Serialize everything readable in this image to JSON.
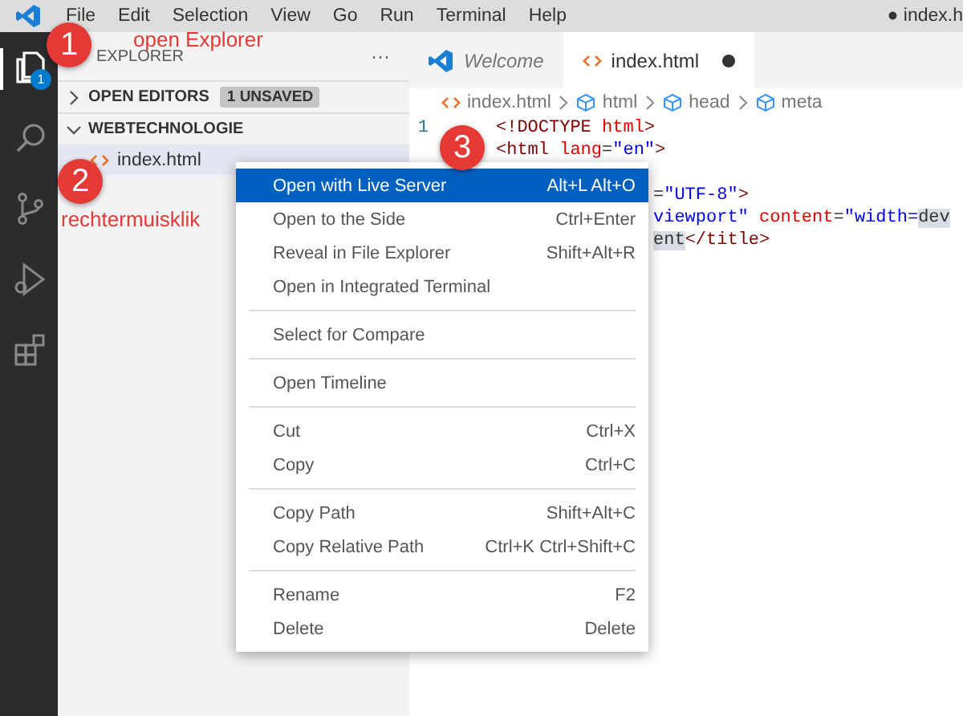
{
  "menubar": {
    "items": [
      "File",
      "Edit",
      "Selection",
      "View",
      "Go",
      "Run",
      "Terminal",
      "Help"
    ],
    "title": "● index.h"
  },
  "activity_bar": [
    {
      "kind": "files",
      "selected": true,
      "badge": "1"
    },
    {
      "kind": "search",
      "selected": false
    },
    {
      "kind": "branch",
      "selected": false
    },
    {
      "kind": "run",
      "selected": false
    },
    {
      "kind": "extensions",
      "selected": false
    }
  ],
  "sidebar": {
    "title": "EXPLORER",
    "more": "···",
    "sections": [
      {
        "label": "OPEN EDITORS",
        "expanded": false,
        "badge": "1 UNSAVED"
      },
      {
        "label": "WEBTECHNOLOGIE",
        "expanded": true,
        "files": [
          {
            "name": "index.html",
            "selected": true
          }
        ]
      }
    ]
  },
  "tabs": [
    {
      "label": "Welcome",
      "kind": "welcome",
      "selected": false,
      "modified": false
    },
    {
      "label": "index.html",
      "kind": "html",
      "selected": true,
      "modified": true
    }
  ],
  "breadcrumbs": [
    {
      "label": "index.html",
      "kind": "html"
    },
    {
      "label": "html",
      "kind": "element"
    },
    {
      "label": "head",
      "kind": "element"
    },
    {
      "label": "meta",
      "kind": "element"
    }
  ],
  "code": [
    {
      "number": "1",
      "kind": "full",
      "tokens": [
        {
          "text": "<!DOCTYPE ",
          "kind": "tag"
        },
        {
          "text": "html",
          "kind": "attr"
        },
        {
          "text": ">",
          "kind": "tag"
        }
      ]
    },
    {
      "kind": "full",
      "tokens": [
        {
          "text": "<html ",
          "kind": "tag"
        },
        {
          "text": "lang",
          "kind": "attr"
        },
        {
          "text": "=",
          "kind": "text"
        },
        {
          "text": "\"en\"",
          "kind": "value"
        },
        {
          "text": ">",
          "kind": "tag"
        }
      ]
    },
    {
      "kind": "partial"
    },
    {
      "kind": "partial",
      "tokens": [
        {
          "text": "=",
          "kind": "text"
        },
        {
          "text": "\"UTF-8\"",
          "kind": "value"
        },
        {
          "text": ">",
          "kind": "tag"
        }
      ]
    },
    {
      "kind": "partial",
      "tokens": [
        {
          "text": "viewport\"",
          "kind": "value"
        },
        {
          "text": " content",
          "kind": "attr"
        },
        {
          "text": "=",
          "kind": "text"
        },
        {
          "text": "\"width=",
          "kind": "value"
        },
        {
          "text": "dev",
          "kind": "highlight"
        }
      ]
    },
    {
      "kind": "partial",
      "tokens": [
        {
          "text": "ent",
          "kind": "highlight"
        },
        {
          "text": "</title>",
          "kind": "tag"
        }
      ]
    }
  ],
  "context_menu": {
    "groups": [
      [
        {
          "label": "Open with Live Server",
          "shortcut": "Alt+L Alt+O",
          "selected": true
        },
        {
          "label": "Open to the Side",
          "shortcut": "Ctrl+Enter",
          "selected": false
        },
        {
          "label": "Reveal in File Explorer",
          "shortcut": "Shift+Alt+R",
          "selected": false
        },
        {
          "label": "Open in Integrated Terminal",
          "selected": false
        }
      ],
      [
        {
          "label": "Select for Compare",
          "selected": false
        }
      ],
      [
        {
          "label": "Open Timeline",
          "selected": false
        }
      ],
      [
        {
          "label": "Cut",
          "shortcut": "Ctrl+X",
          "selected": false
        },
        {
          "label": "Copy",
          "shortcut": "Ctrl+C",
          "selected": false
        }
      ],
      [
        {
          "label": "Copy Path",
          "shortcut": "Shift+Alt+C",
          "selected": false
        },
        {
          "label": "Copy Relative Path",
          "shortcut": "Ctrl+K Ctrl+Shift+C",
          "selected": false
        }
      ],
      [
        {
          "label": "Rename",
          "shortcut": "F2",
          "selected": false
        },
        {
          "label": "Delete",
          "shortcut": "Delete",
          "selected": false
        }
      ]
    ]
  },
  "annotations": [
    {
      "number": "1",
      "label": "open Explorer",
      "kind": "top"
    },
    {
      "number": "2",
      "label": "rechtermuisklik",
      "kind": "sidebar"
    },
    {
      "number": "3",
      "kind": "menu"
    }
  ]
}
